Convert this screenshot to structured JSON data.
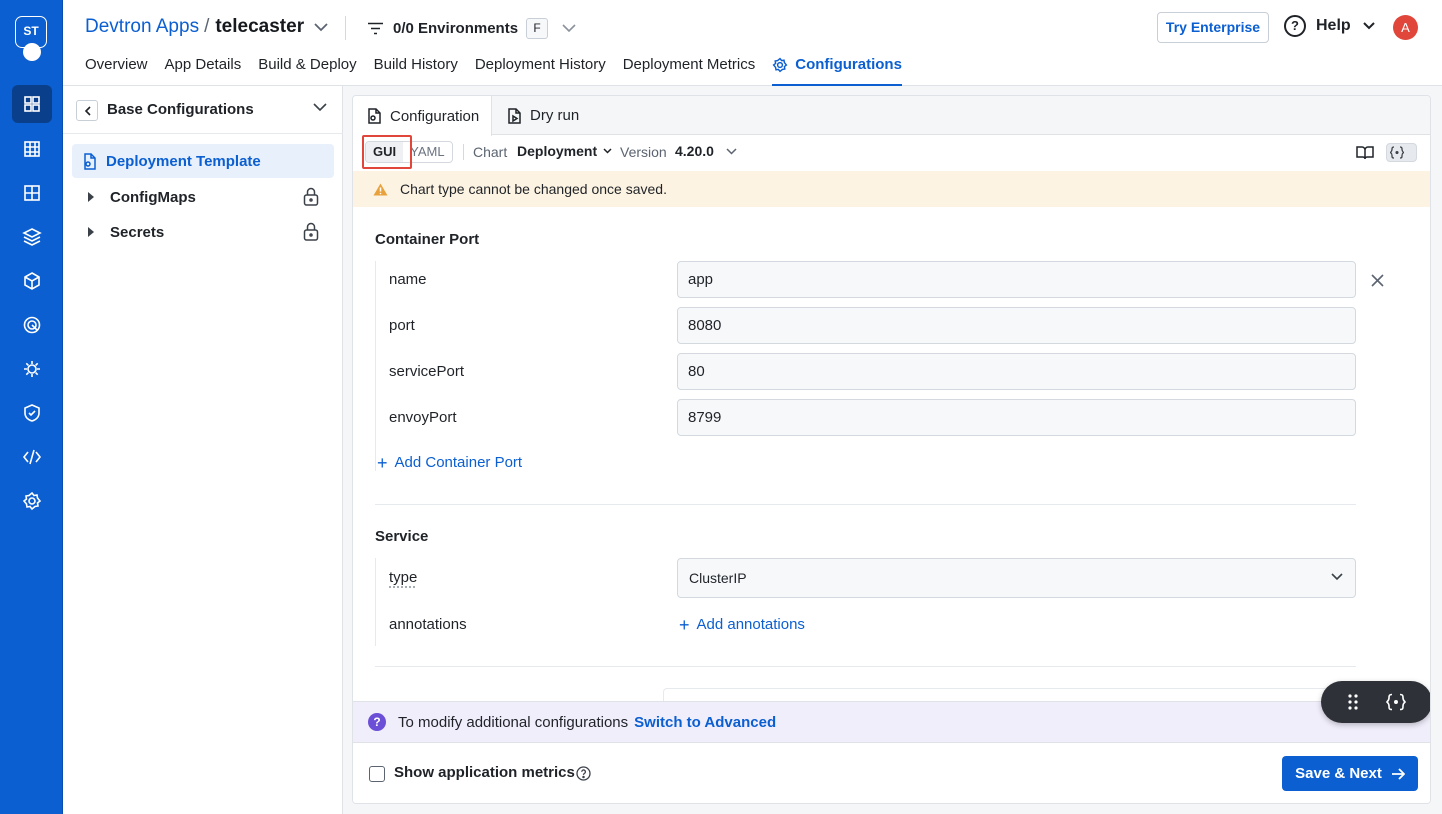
{
  "rail": {
    "logo_text": "ST",
    "items": [
      {
        "icon": "grid-apps-icon",
        "active": true
      },
      {
        "icon": "chart-bars-icon"
      },
      {
        "icon": "app-group-icon"
      },
      {
        "icon": "layers-stack-icon"
      },
      {
        "icon": "cube-icon"
      },
      {
        "icon": "target-icon"
      },
      {
        "icon": "gear-bug-icon"
      },
      {
        "icon": "shield-check-icon"
      },
      {
        "icon": "code-icon"
      },
      {
        "icon": "settings-icon"
      }
    ]
  },
  "header": {
    "breadcrumb_root": "Devtron Apps",
    "breadcrumb_sep": "/",
    "app_name": "telecaster",
    "environments_label": "0/0 Environments",
    "environments_badge": "F",
    "try_enterprise": "Try Enterprise",
    "help": "Help",
    "avatar_initial": "A",
    "tabs": [
      "Overview",
      "App Details",
      "Build & Deploy",
      "Build History",
      "Deployment History",
      "Deployment Metrics",
      "Configurations"
    ],
    "active_tab": "Configurations"
  },
  "sidebar": {
    "title": "Base Configurations",
    "active_item": "Deployment Template",
    "items": [
      {
        "label": "ConfigMaps",
        "locked": true
      },
      {
        "label": "Secrets",
        "locked": true
      }
    ]
  },
  "panel": {
    "tabs": [
      "Configuration",
      "Dry run"
    ],
    "active_tab": "Configuration",
    "mode_options": [
      "GUI",
      "YAML"
    ],
    "active_mode": "GUI",
    "chart_label": "Chart",
    "chart_value": "Deployment",
    "version_label": "Version",
    "version_value": "4.20.0",
    "warning": "Chart type cannot be changed once saved.",
    "container_port": {
      "title": "Container Port",
      "fields": [
        {
          "label": "name",
          "value": "app"
        },
        {
          "label": "port",
          "value": "8080"
        },
        {
          "label": "servicePort",
          "value": "80"
        },
        {
          "label": "envoyPort",
          "value": "8799"
        }
      ],
      "add_label": "Add Container Port"
    },
    "service": {
      "title": "Service",
      "type_label": "type",
      "type_value": "ClusterIP",
      "annotations_label": "annotations",
      "add_annotations": "Add annotations"
    },
    "advanced_bar": {
      "text": "To modify additional configurations",
      "link": "Switch to Advanced"
    },
    "footer": {
      "show_metrics": "Show application metrics",
      "show_metrics_checked": false,
      "save": "Save & Next"
    }
  },
  "colors": {
    "primary": "#0b5fd1",
    "warning_bg": "#fdf3e2",
    "advanced_bg": "#f1eefc",
    "highlight": "#e0463a"
  }
}
